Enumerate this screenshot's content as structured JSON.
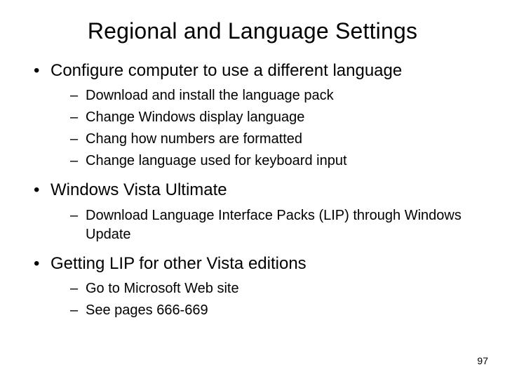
{
  "title": "Regional and Language Settings",
  "bullets": {
    "b0": {
      "text": "Configure computer to use a different language",
      "sub": [
        "Download and install the language pack",
        "Change Windows display language",
        "Chang how numbers are formatted",
        "Change language used for keyboard input"
      ]
    },
    "b1": {
      "text": "Windows Vista Ultimate",
      "sub": [
        "Download Language Interface Packs (LIP) through Windows Update"
      ]
    },
    "b2": {
      "text": "Getting LIP for other Vista editions",
      "sub": [
        "Go to Microsoft Web site",
        "See pages 666-669"
      ]
    }
  },
  "page_number": "97"
}
